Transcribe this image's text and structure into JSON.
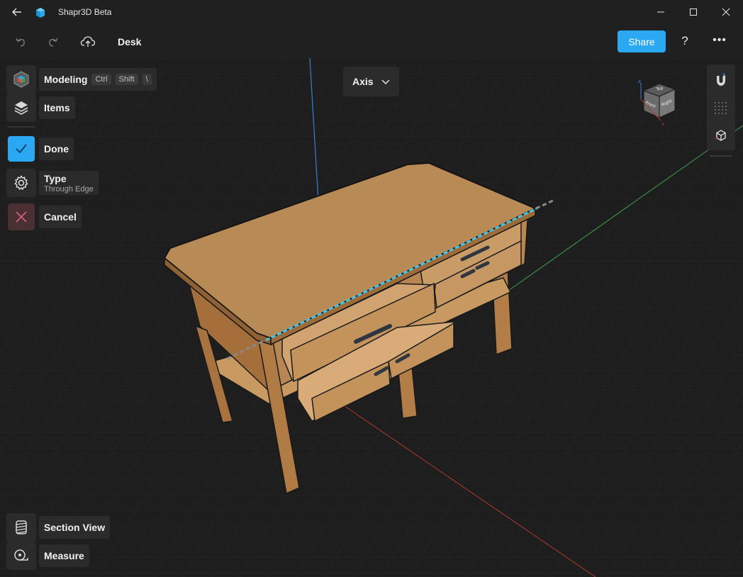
{
  "window": {
    "title": "Shapr3D Beta",
    "minimize_icon": "minimize-icon",
    "maximize_icon": "maximize-icon",
    "close_icon": "close-icon"
  },
  "toolbar": {
    "document_name": "Desk",
    "share_label": "Share",
    "help_label": "?",
    "more_label": "•••"
  },
  "left_panel": {
    "modeling": {
      "label": "Modeling",
      "shortcut": [
        "Ctrl",
        "Shift",
        "\\"
      ]
    },
    "items": {
      "label": "Items"
    },
    "done": {
      "label": "Done"
    },
    "type": {
      "label": "Type",
      "value": "Through Edge"
    },
    "cancel": {
      "label": "Cancel"
    },
    "section_view": {
      "label": "Section View"
    },
    "measure": {
      "label": "Measure"
    }
  },
  "axis_dropdown": {
    "label": "Axis"
  },
  "view_cube": {
    "faces": [
      "Top",
      "Front",
      "Right"
    ],
    "axes": [
      "z",
      "x"
    ]
  },
  "colors": {
    "accent": "#2aa8f2",
    "cancel_bg": "#4a2f33",
    "wood": "#b88a55",
    "axis_x": "#c0392b",
    "axis_y": "#3fa34d",
    "axis_z": "#3b7fd1"
  }
}
